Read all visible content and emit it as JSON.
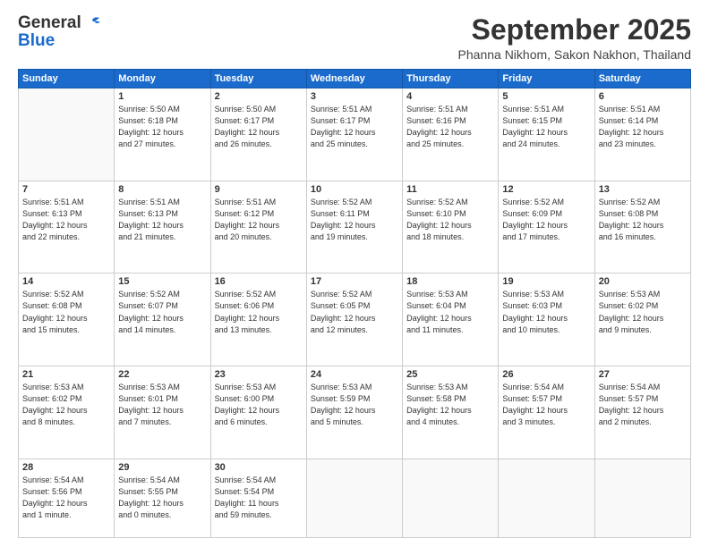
{
  "header": {
    "logo_line1": "General",
    "logo_line2": "Blue",
    "month": "September 2025",
    "location": "Phanna Nikhom, Sakon Nakhon, Thailand"
  },
  "days_of_week": [
    "Sunday",
    "Monday",
    "Tuesday",
    "Wednesday",
    "Thursday",
    "Friday",
    "Saturday"
  ],
  "weeks": [
    [
      {
        "day": "",
        "info": ""
      },
      {
        "day": "1",
        "info": "Sunrise: 5:50 AM\nSunset: 6:18 PM\nDaylight: 12 hours\nand 27 minutes."
      },
      {
        "day": "2",
        "info": "Sunrise: 5:50 AM\nSunset: 6:17 PM\nDaylight: 12 hours\nand 26 minutes."
      },
      {
        "day": "3",
        "info": "Sunrise: 5:51 AM\nSunset: 6:17 PM\nDaylight: 12 hours\nand 25 minutes."
      },
      {
        "day": "4",
        "info": "Sunrise: 5:51 AM\nSunset: 6:16 PM\nDaylight: 12 hours\nand 25 minutes."
      },
      {
        "day": "5",
        "info": "Sunrise: 5:51 AM\nSunset: 6:15 PM\nDaylight: 12 hours\nand 24 minutes."
      },
      {
        "day": "6",
        "info": "Sunrise: 5:51 AM\nSunset: 6:14 PM\nDaylight: 12 hours\nand 23 minutes."
      }
    ],
    [
      {
        "day": "7",
        "info": "Sunrise: 5:51 AM\nSunset: 6:13 PM\nDaylight: 12 hours\nand 22 minutes."
      },
      {
        "day": "8",
        "info": "Sunrise: 5:51 AM\nSunset: 6:13 PM\nDaylight: 12 hours\nand 21 minutes."
      },
      {
        "day": "9",
        "info": "Sunrise: 5:51 AM\nSunset: 6:12 PM\nDaylight: 12 hours\nand 20 minutes."
      },
      {
        "day": "10",
        "info": "Sunrise: 5:52 AM\nSunset: 6:11 PM\nDaylight: 12 hours\nand 19 minutes."
      },
      {
        "day": "11",
        "info": "Sunrise: 5:52 AM\nSunset: 6:10 PM\nDaylight: 12 hours\nand 18 minutes."
      },
      {
        "day": "12",
        "info": "Sunrise: 5:52 AM\nSunset: 6:09 PM\nDaylight: 12 hours\nand 17 minutes."
      },
      {
        "day": "13",
        "info": "Sunrise: 5:52 AM\nSunset: 6:08 PM\nDaylight: 12 hours\nand 16 minutes."
      }
    ],
    [
      {
        "day": "14",
        "info": "Sunrise: 5:52 AM\nSunset: 6:08 PM\nDaylight: 12 hours\nand 15 minutes."
      },
      {
        "day": "15",
        "info": "Sunrise: 5:52 AM\nSunset: 6:07 PM\nDaylight: 12 hours\nand 14 minutes."
      },
      {
        "day": "16",
        "info": "Sunrise: 5:52 AM\nSunset: 6:06 PM\nDaylight: 12 hours\nand 13 minutes."
      },
      {
        "day": "17",
        "info": "Sunrise: 5:52 AM\nSunset: 6:05 PM\nDaylight: 12 hours\nand 12 minutes."
      },
      {
        "day": "18",
        "info": "Sunrise: 5:53 AM\nSunset: 6:04 PM\nDaylight: 12 hours\nand 11 minutes."
      },
      {
        "day": "19",
        "info": "Sunrise: 5:53 AM\nSunset: 6:03 PM\nDaylight: 12 hours\nand 10 minutes."
      },
      {
        "day": "20",
        "info": "Sunrise: 5:53 AM\nSunset: 6:02 PM\nDaylight: 12 hours\nand 9 minutes."
      }
    ],
    [
      {
        "day": "21",
        "info": "Sunrise: 5:53 AM\nSunset: 6:02 PM\nDaylight: 12 hours\nand 8 minutes."
      },
      {
        "day": "22",
        "info": "Sunrise: 5:53 AM\nSunset: 6:01 PM\nDaylight: 12 hours\nand 7 minutes."
      },
      {
        "day": "23",
        "info": "Sunrise: 5:53 AM\nSunset: 6:00 PM\nDaylight: 12 hours\nand 6 minutes."
      },
      {
        "day": "24",
        "info": "Sunrise: 5:53 AM\nSunset: 5:59 PM\nDaylight: 12 hours\nand 5 minutes."
      },
      {
        "day": "25",
        "info": "Sunrise: 5:53 AM\nSunset: 5:58 PM\nDaylight: 12 hours\nand 4 minutes."
      },
      {
        "day": "26",
        "info": "Sunrise: 5:54 AM\nSunset: 5:57 PM\nDaylight: 12 hours\nand 3 minutes."
      },
      {
        "day": "27",
        "info": "Sunrise: 5:54 AM\nSunset: 5:57 PM\nDaylight: 12 hours\nand 2 minutes."
      }
    ],
    [
      {
        "day": "28",
        "info": "Sunrise: 5:54 AM\nSunset: 5:56 PM\nDaylight: 12 hours\nand 1 minute."
      },
      {
        "day": "29",
        "info": "Sunrise: 5:54 AM\nSunset: 5:55 PM\nDaylight: 12 hours\nand 0 minutes."
      },
      {
        "day": "30",
        "info": "Sunrise: 5:54 AM\nSunset: 5:54 PM\nDaylight: 11 hours\nand 59 minutes."
      },
      {
        "day": "",
        "info": ""
      },
      {
        "day": "",
        "info": ""
      },
      {
        "day": "",
        "info": ""
      },
      {
        "day": "",
        "info": ""
      }
    ]
  ]
}
